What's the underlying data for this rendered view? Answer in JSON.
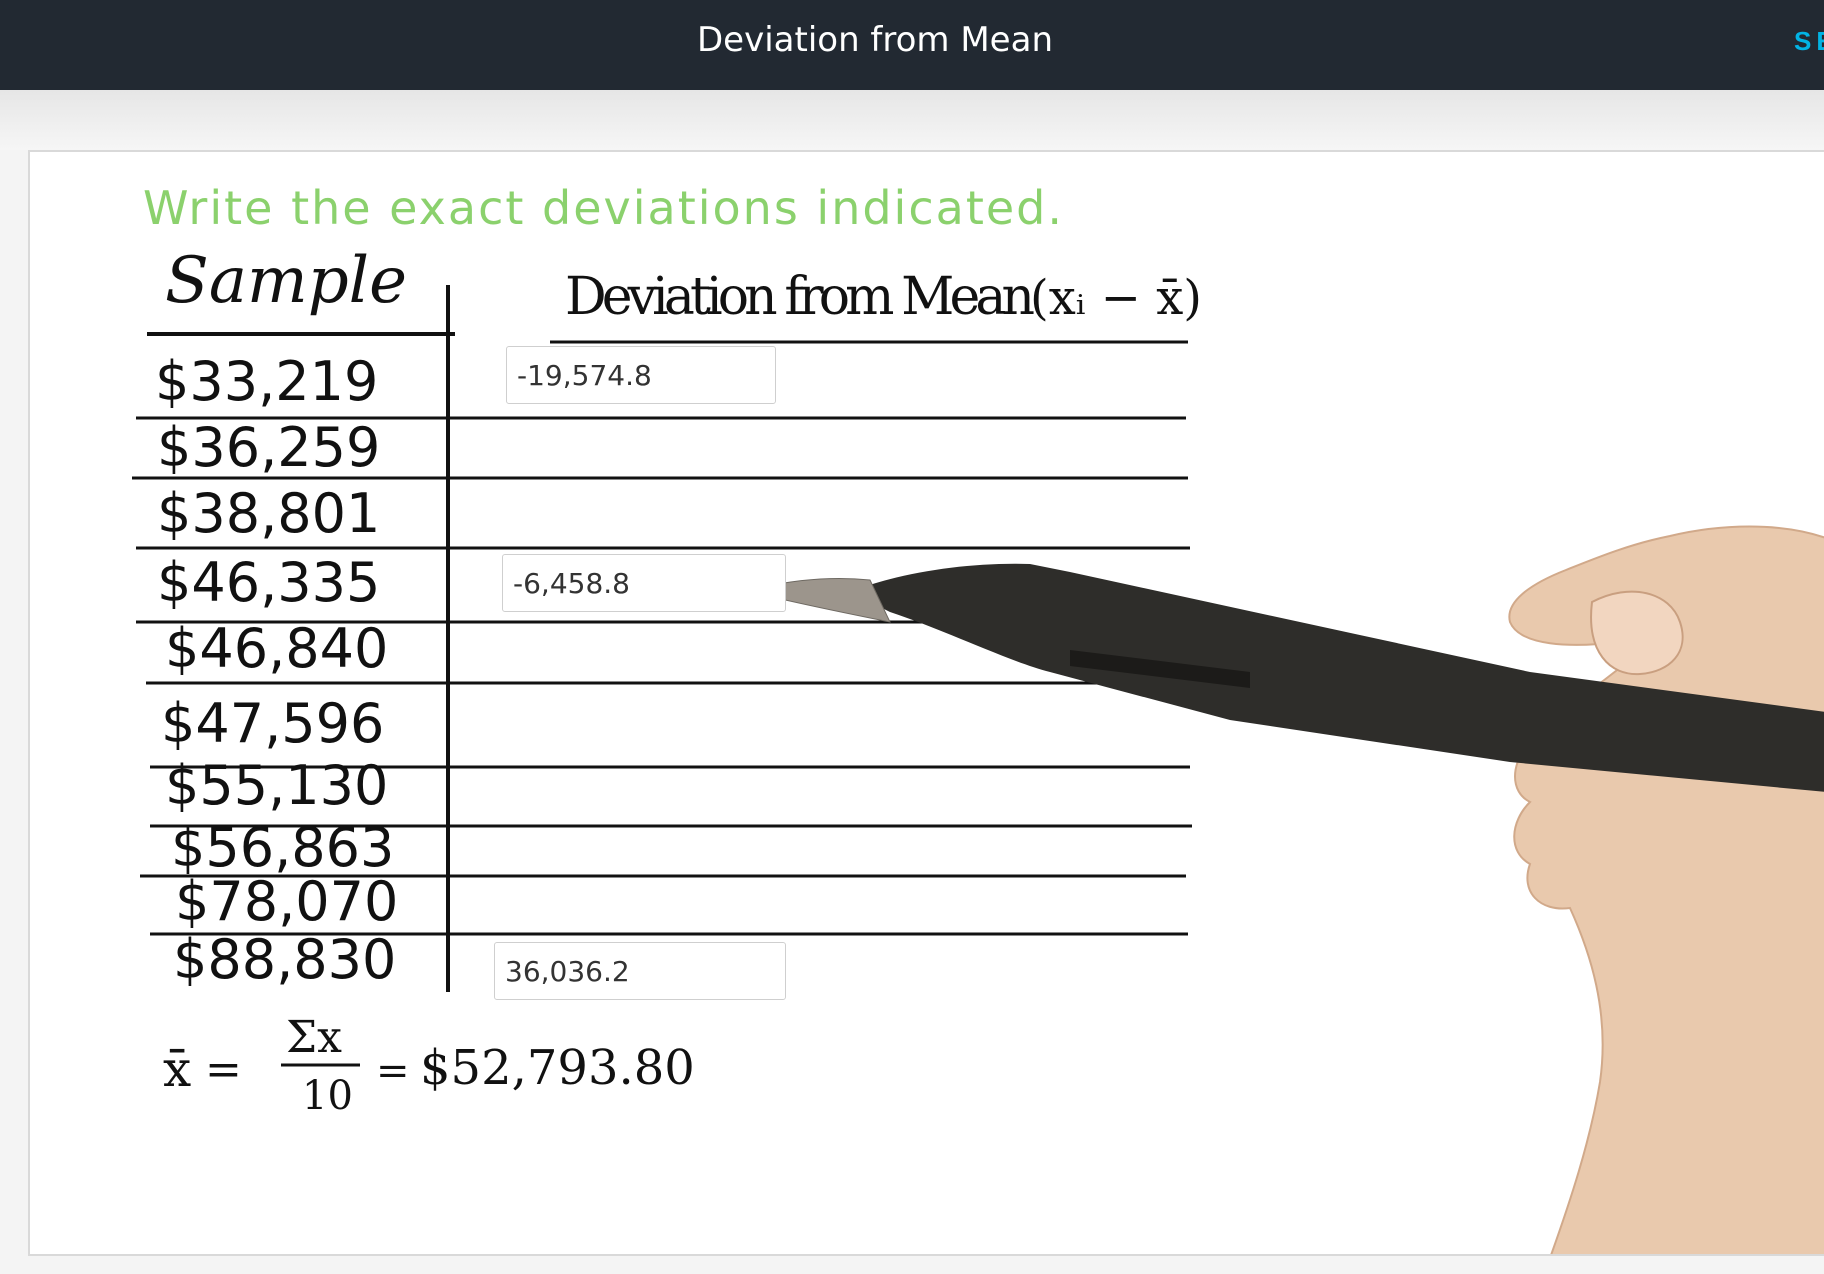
{
  "header": {
    "title": "Deviation from Mean",
    "action_label": "SE"
  },
  "quiz": {
    "instruction": "Write the exact deviations indicated.",
    "col_sample": "Sample",
    "col_deviation": "Deviation from Mean",
    "col_formula": "(xᵢ − x̄)",
    "samples": [
      "$33,219",
      "$36,259",
      "$38,801",
      "$46,335",
      "$46,840",
      "$47,596",
      "$55,130",
      "$56,863",
      "$78,070",
      "$88,830"
    ],
    "answers": [
      {
        "row": 1,
        "value": "-19,574.8"
      },
      {
        "row": 4,
        "value": "-6,458.8"
      },
      {
        "row": 10,
        "value": "36,036.2"
      }
    ],
    "mean_formula": {
      "xbar": "x̄",
      "eq": "=",
      "numerator": "Σx",
      "denominator": "10",
      "eq2": "=",
      "result": "$52,793.80"
    }
  },
  "colors": {
    "header_bg": "#222932",
    "accent": "#02b3e4",
    "instruction_green": "#8bd16d",
    "ink": "#111111"
  }
}
